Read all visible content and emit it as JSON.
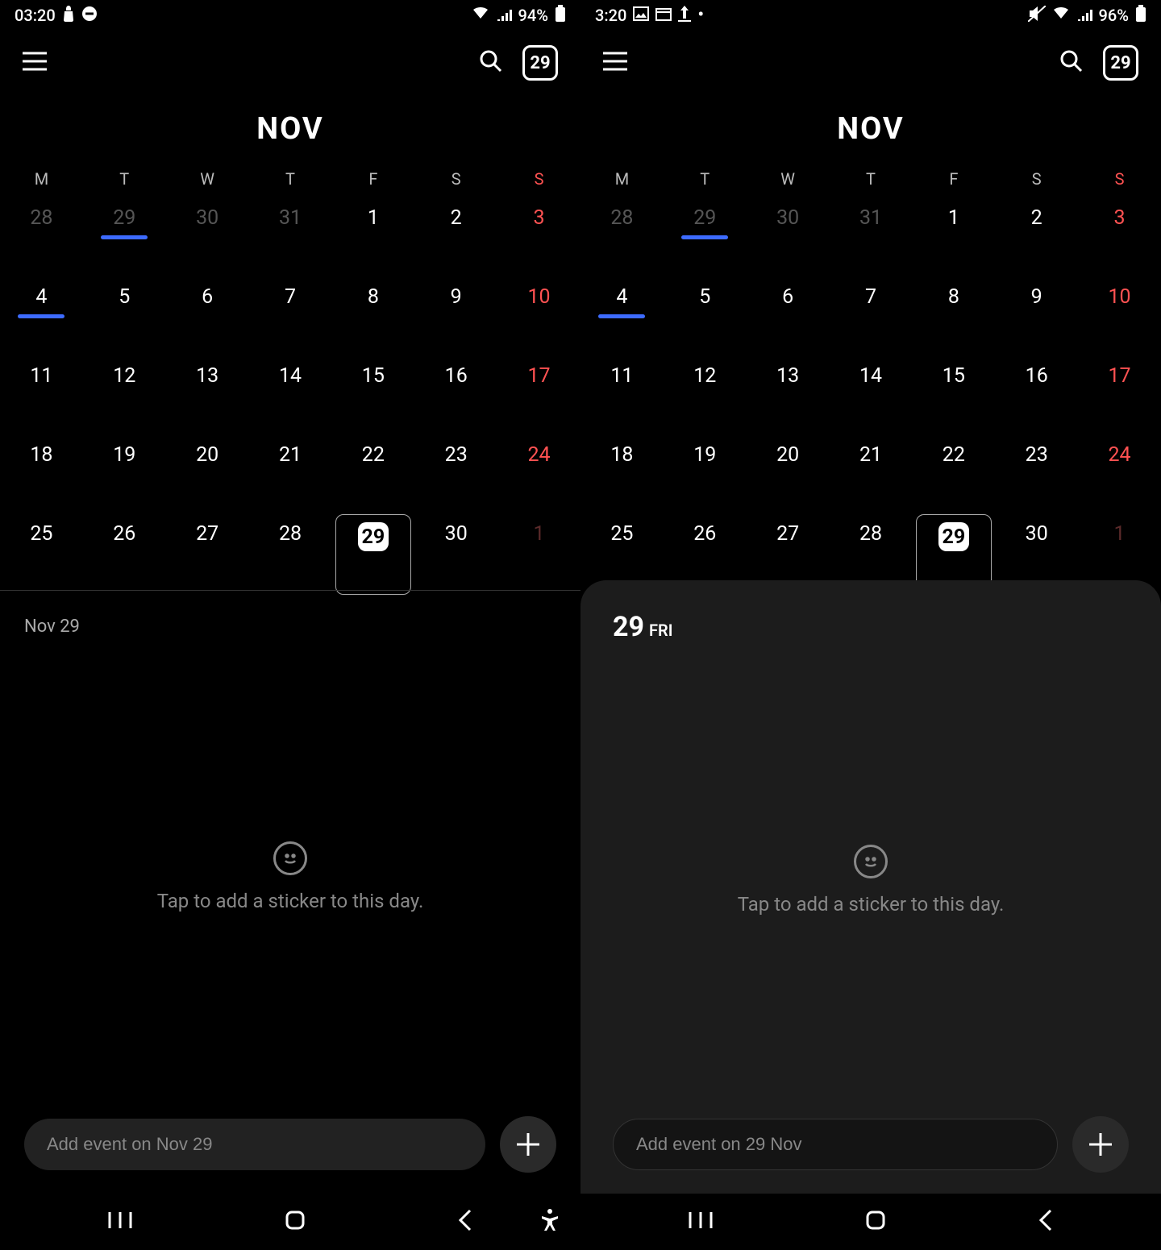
{
  "left": {
    "status": {
      "time": "03:20",
      "battery_pct": "94%"
    },
    "appbar": {
      "today_badge": "29"
    },
    "month_label": "NOV",
    "weekdays": [
      "M",
      "T",
      "W",
      "T",
      "F",
      "S",
      "S"
    ],
    "weeks": [
      [
        {
          "d": "28",
          "o": true
        },
        {
          "d": "29",
          "o": true,
          "u": true
        },
        {
          "d": "30",
          "o": true
        },
        {
          "d": "31",
          "o": true
        },
        {
          "d": "1"
        },
        {
          "d": "2"
        },
        {
          "d": "3",
          "sun": true
        }
      ],
      [
        {
          "d": "4",
          "u": true
        },
        {
          "d": "5"
        },
        {
          "d": "6"
        },
        {
          "d": "7"
        },
        {
          "d": "8"
        },
        {
          "d": "9"
        },
        {
          "d": "10",
          "sun": true
        }
      ],
      [
        {
          "d": "11"
        },
        {
          "d": "12"
        },
        {
          "d": "13"
        },
        {
          "d": "14"
        },
        {
          "d": "15"
        },
        {
          "d": "16"
        },
        {
          "d": "17",
          "sun": true
        }
      ],
      [
        {
          "d": "18"
        },
        {
          "d": "19"
        },
        {
          "d": "20"
        },
        {
          "d": "21"
        },
        {
          "d": "22"
        },
        {
          "d": "23"
        },
        {
          "d": "24",
          "sun": true
        }
      ],
      [
        {
          "d": "25"
        },
        {
          "d": "26"
        },
        {
          "d": "27"
        },
        {
          "d": "28"
        },
        {
          "d": "29",
          "pill": true,
          "sel": true
        },
        {
          "d": "30"
        },
        {
          "d": "1",
          "sun": true,
          "o": true
        }
      ]
    ],
    "lower": {
      "heading": "Nov 29",
      "sticker_text": "Tap to add a sticker to this day.",
      "placeholder": "Add event on Nov 29"
    }
  },
  "right": {
    "status": {
      "time": "3:20",
      "battery_pct": "96%"
    },
    "appbar": {
      "today_badge": "29"
    },
    "month_label": "NOV",
    "weekdays": [
      "M",
      "T",
      "W",
      "T",
      "F",
      "S",
      "S"
    ],
    "weeks": [
      [
        {
          "d": "28",
          "o": true
        },
        {
          "d": "29",
          "o": true,
          "u": true
        },
        {
          "d": "30",
          "o": true
        },
        {
          "d": "31",
          "o": true
        },
        {
          "d": "1"
        },
        {
          "d": "2"
        },
        {
          "d": "3",
          "sun": true
        }
      ],
      [
        {
          "d": "4",
          "u": true
        },
        {
          "d": "5"
        },
        {
          "d": "6"
        },
        {
          "d": "7"
        },
        {
          "d": "8"
        },
        {
          "d": "9"
        },
        {
          "d": "10",
          "sun": true
        }
      ],
      [
        {
          "d": "11"
        },
        {
          "d": "12"
        },
        {
          "d": "13"
        },
        {
          "d": "14"
        },
        {
          "d": "15"
        },
        {
          "d": "16"
        },
        {
          "d": "17",
          "sun": true
        }
      ],
      [
        {
          "d": "18"
        },
        {
          "d": "19"
        },
        {
          "d": "20"
        },
        {
          "d": "21"
        },
        {
          "d": "22"
        },
        {
          "d": "23"
        },
        {
          "d": "24",
          "sun": true
        }
      ],
      [
        {
          "d": "25"
        },
        {
          "d": "26"
        },
        {
          "d": "27"
        },
        {
          "d": "28"
        },
        {
          "d": "29",
          "pill": true,
          "sel": true
        },
        {
          "d": "30"
        },
        {
          "d": "1",
          "sun": true,
          "o": true
        }
      ]
    ],
    "lower": {
      "heading_day": "29",
      "heading_dow": "FRI",
      "sticker_text": "Tap to add a sticker to this day.",
      "placeholder": "Add event on 29 Nov"
    }
  }
}
